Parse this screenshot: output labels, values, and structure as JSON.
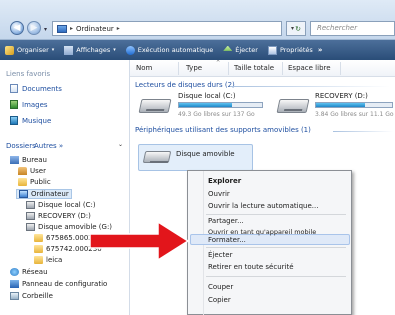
{
  "address_bar": {
    "path_segment": "Ordinateur",
    "separator": "▸",
    "search_placeholder": "Rechercher",
    "nav_back_glyph": "◀",
    "nav_forward_glyph": "▶",
    "nav_dropdown_glyph": "▾",
    "refresh_glyph": "↻"
  },
  "toolbar": {
    "organiser": "Organiser",
    "affichages": "Affichages",
    "execution_auto": "Exécution automatique",
    "ejecter": "Éjecter",
    "proprietes": "Propriétés",
    "caret": "▾",
    "more": "»"
  },
  "left_pane": {
    "favorites_title": "Liens favoris",
    "favorites": [
      "Documents",
      "Images",
      "Musique"
    ],
    "more_label": "Autres »",
    "folders_title": "Dossiers",
    "folders_caret": "⌄",
    "tree": [
      "Bureau",
      "User",
      "Public",
      "Ordinateur",
      "Disque local (C:)",
      "RECOVERY (D:)",
      "Disque amovible (G:)",
      "675865.000244",
      "675742.000230",
      "leica",
      "Réseau",
      "Panneau de configuratio",
      "Corbeille"
    ]
  },
  "columns": {
    "nom": "Nom",
    "type": "Type",
    "taille": "Taille totale",
    "espace": "Espace libre",
    "caret": "^"
  },
  "groups": {
    "hard_disks": "Lecteurs de disques durs (2)",
    "removable": "Périphériques utilisant des supports amovibles (1)"
  },
  "drives": {
    "c_name": "Disque local (C:)",
    "c_free": "49.3 Go libres sur 137 Go",
    "c_used_fraction": 0.64,
    "d_name": "RECOVERY (D:)",
    "d_free": "3.84 Go libres sur 11.1 Go",
    "d_used_fraction": 0.65,
    "g_name": "Disque amovible (G:)"
  },
  "context_menu": {
    "items": [
      "Explorer",
      "Ouvrir",
      "Ouvrir la lecture automatique...",
      "Partager...",
      "Ouvrir en tant qu'appareil mobile",
      "Formater...",
      "Éjecter",
      "Retirer en toute sécurité",
      "Couper",
      "Copier"
    ]
  },
  "colors": {
    "arrow": "#e2151b",
    "toolbar": "#2f557f",
    "link": "#1f4fa0"
  }
}
